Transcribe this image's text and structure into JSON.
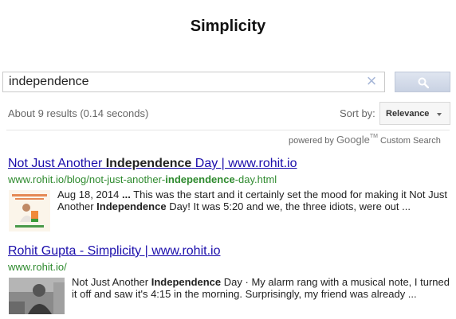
{
  "page": {
    "title": "Simplicity"
  },
  "search": {
    "value": "independence",
    "clear_symbol": "×"
  },
  "results_meta": {
    "stats": "About 9 results (0.14 seconds)",
    "sort_label": "Sort by:",
    "sort_value": "Relevance"
  },
  "branding": {
    "powered_by": "powered by",
    "logo_text": "Google",
    "tm": "TM",
    "custom_search": "Custom Search"
  },
  "results": [
    {
      "title_pre": "Not Just Another ",
      "title_bold": "Independence",
      "title_post": " Day | www.rohit.io",
      "url_pre": "www.rohit.io/blog/not-just-another-",
      "url_bold": "independence",
      "url_post": "-day.html",
      "date": "Aug 18, 2014",
      "ellipsis": "...",
      "snippet_pre": " This was the start and it certainly set the mood for making it Not Just Another ",
      "snippet_bold": "Independence",
      "snippet_post": " Day! It was 5:20 and we, the three idiots, were out ..."
    },
    {
      "title": "Rohit Gupta - Simplicity | www.rohit.io",
      "url": "www.rohit.io/",
      "snippet_pre": "Not Just Another ",
      "snippet_bold": "Independence",
      "snippet_post": " Day · My alarm rang with a musical note, I turned it off and saw it's 4:15 in the morning. Surprisingly, my friend was already ..."
    }
  ]
}
